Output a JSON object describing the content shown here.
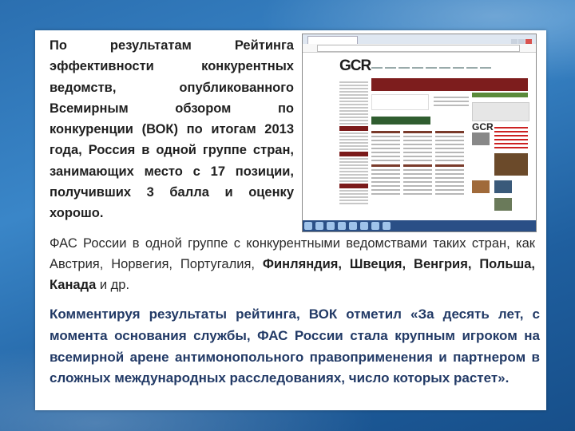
{
  "lead_paragraph": "По результатам Рейтинга эффективности конкурентных ведомств, опубликованного Всемирным обзором по конкуренции (ВОК) по итогам 2013 года, Россия в одной группе стран, занимающих место с 17 позиции, получивших 3 балла и оценку хорошо.",
  "paragraph2": {
    "text_start": "ФАС России в одной группе с конкурентными ведомствами таких стран, как Австрия, Норвегия, Португалия, ",
    "bold_countries": "Финляндия, Швеция, Венгрия, Польша, Канада",
    "text_end": " и др."
  },
  "paragraph3": "Комментируя результаты рейтинга, ВОК отметил «За десять лет, с момента основания службы, ФАС России стала крупным игроком на всемирной арене антимонопольного правоприменения и партнером в сложных международных расследованиях, число которых растет».",
  "browser_screenshot": {
    "logo_main": "GCR",
    "colors": {
      "banner": "#7d1d1d",
      "nav": "#7b1a1a",
      "taskbar": "#2a4f86"
    }
  }
}
